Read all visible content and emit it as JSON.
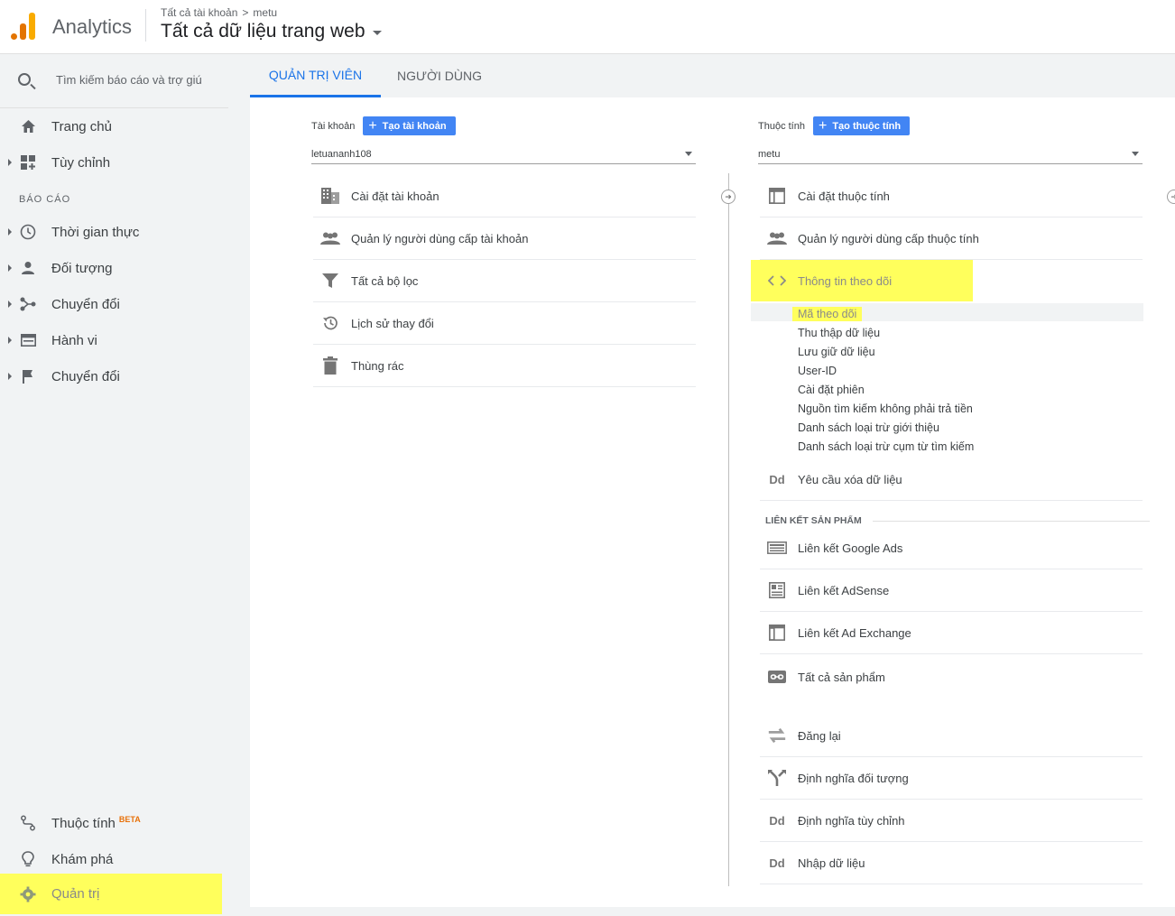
{
  "header": {
    "app_name": "Analytics",
    "breadcrumb": [
      "Tất cả tài khoản",
      ">",
      "metu"
    ],
    "view_title": "Tất cả dữ liệu trang web"
  },
  "sidebar": {
    "search_placeholder": "Tìm kiếm báo cáo và trợ giúp",
    "top_items": [
      {
        "label": "Trang chủ",
        "icon": "home-icon"
      },
      {
        "label": "Tùy chỉnh",
        "icon": "dashboard-icon"
      }
    ],
    "section_label": "BÁO CÁO",
    "report_items": [
      {
        "label": "Thời gian thực",
        "icon": "clock-icon"
      },
      {
        "label": "Đối tượng",
        "icon": "person-icon"
      },
      {
        "label": "Chuyển đổi",
        "icon": "acquisition-icon"
      },
      {
        "label": "Hành vi",
        "icon": "behavior-icon"
      },
      {
        "label": "Chuyển đổi",
        "icon": "flag-icon"
      }
    ],
    "bottom_items": [
      {
        "label": "Thuộc tính",
        "icon": "attribution-icon",
        "badge": "BETA"
      },
      {
        "label": "Khám phá",
        "icon": "lightbulb-icon"
      },
      {
        "label": "Quản trị",
        "icon": "gear-icon"
      }
    ]
  },
  "tabs": [
    "QUẢN TRỊ VIÊN",
    "NGƯỜI DÙNG"
  ],
  "account_col": {
    "label": "Tài khoản",
    "button": "Tạo tài khoản",
    "selected": "letuananh108",
    "items": [
      {
        "label": "Cài đặt tài khoản",
        "icon": "building-icon"
      },
      {
        "label": "Quản lý người dùng cấp tài khoản",
        "icon": "people-icon"
      },
      {
        "label": "Tất cả bộ lọc",
        "icon": "filter-icon"
      },
      {
        "label": "Lịch sử thay đổi",
        "icon": "history-icon"
      },
      {
        "label": "Thùng rác",
        "icon": "trash-icon"
      }
    ]
  },
  "property_col": {
    "label": "Thuộc tính",
    "button": "Tạo thuộc tính",
    "selected": "metu",
    "items": [
      {
        "label": "Cài đặt thuộc tính",
        "icon": "property-icon"
      },
      {
        "label": "Quản lý người dùng cấp thuộc tính",
        "icon": "people-icon"
      },
      {
        "label": "Thông tin theo dõi",
        "icon": "code-icon"
      }
    ],
    "tracking_sub": [
      "Mã theo dõi",
      "Thu thập dữ liệu",
      "Lưu giữ dữ liệu",
      "User-ID",
      "Cài đặt phiên",
      "Nguồn tìm kiếm không phải trả tiền",
      "Danh sách loại trừ giới thiệu",
      "Danh sách loại trừ cụm từ tìm kiếm"
    ],
    "delete_request": {
      "label": "Yêu cầu xóa dữ liệu",
      "icon_text": "Dd"
    },
    "product_links_label": "LIÊN KẾT SẢN PHẨM",
    "product_links": [
      {
        "label": "Liên kết Google Ads",
        "icon": "ads-icon"
      },
      {
        "label": "Liên kết AdSense",
        "icon": "adsense-icon"
      },
      {
        "label": "Liên kết Ad Exchange",
        "icon": "adexchange-icon"
      },
      {
        "label": "Tất cả sản phẩm",
        "icon": "link-icon"
      }
    ],
    "more_items": [
      {
        "label": "Đăng lại",
        "icon": "remarketing-icon"
      },
      {
        "label": "Định nghĩa đối tượng",
        "icon": "fork-icon"
      },
      {
        "label": "Định nghĩa tùy chỉnh",
        "icon_text": "Dd"
      },
      {
        "label": "Nhập dữ liệu",
        "icon_text": "Dd"
      }
    ]
  },
  "colors": {
    "accent": "#1a73e8",
    "button": "#4285f4",
    "highlight": "#ffff5c"
  }
}
